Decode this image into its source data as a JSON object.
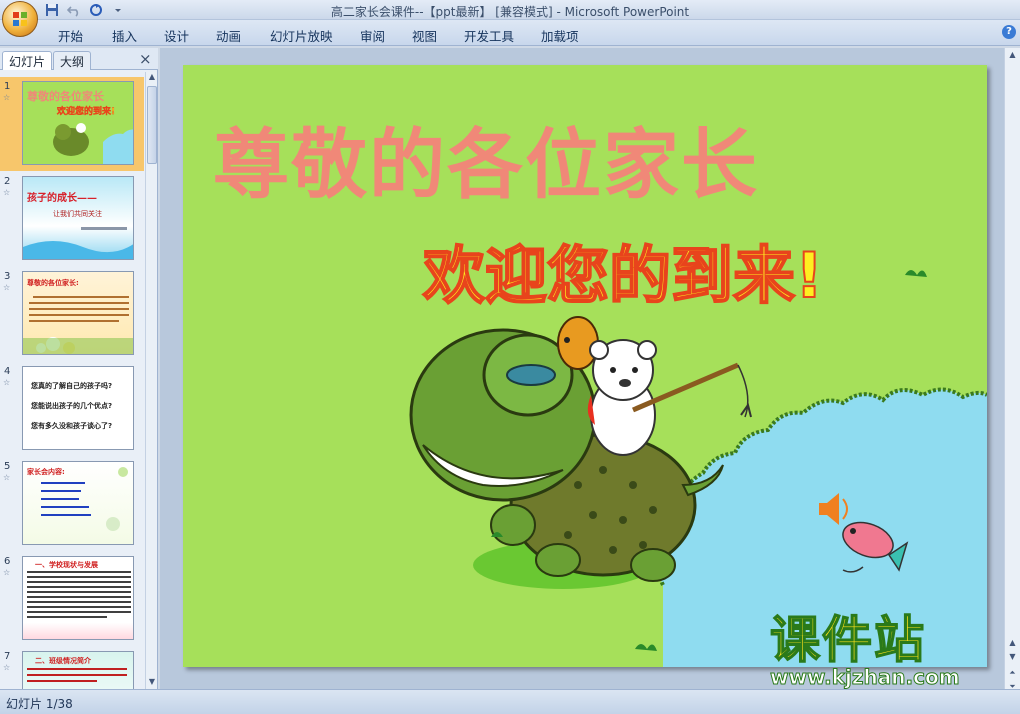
{
  "window": {
    "title": "高二家长会课件--【ppt最新】 [兼容模式] - Microsoft PowerPoint"
  },
  "quick_access": [
    {
      "icon": "save-icon"
    },
    {
      "icon": "undo-icon"
    },
    {
      "icon": "redo-icon"
    },
    {
      "icon": "customize-dropdown-icon"
    }
  ],
  "menu": {
    "items": [
      {
        "label": "开始"
      },
      {
        "label": "插入"
      },
      {
        "label": "设计"
      },
      {
        "label": "动画"
      },
      {
        "label": "幻灯片放映"
      },
      {
        "label": "审阅"
      },
      {
        "label": "视图"
      },
      {
        "label": "开发工具"
      },
      {
        "label": "加载项"
      }
    ],
    "help_icon": "?"
  },
  "left_panel": {
    "tabs": [
      {
        "label": "幻灯片"
      },
      {
        "label": "大纲"
      }
    ],
    "close": "×",
    "slides": [
      {
        "num": "1",
        "star": "☆",
        "title": "尊敬的各位家长",
        "subtitle": "欢迎您的到来!"
      },
      {
        "num": "2",
        "star": "☆",
        "title": "孩子的成长——",
        "subtitle": "让我们共同关注"
      },
      {
        "num": "3",
        "star": "☆",
        "title": "尊敬的各位家长:"
      },
      {
        "num": "4",
        "star": "☆",
        "lines": [
          "您真的了解自己的孩子吗?",
          "您能说出孩子的几个优点?",
          "您有多久没和孩子谈心了?"
        ]
      },
      {
        "num": "5",
        "star": "☆",
        "title": "家长会内容:"
      },
      {
        "num": "6",
        "star": "☆",
        "title": "一、学校现状与发展"
      },
      {
        "num": "7",
        "star": "☆",
        "title": "二、班级情况简介"
      }
    ]
  },
  "slide": {
    "title": "尊敬的各位家长",
    "subtitle": "欢迎您的到来!"
  },
  "status": {
    "text": "幻灯片 1/38"
  },
  "watermark": {
    "main": "课件站",
    "url": "www.kjzhan.com"
  },
  "colors": {
    "slide_bg": "#a6e05a",
    "title_color": "#f08878",
    "subtitle_color": "#ffee20",
    "water": "#8fdcf0",
    "selected_thumb": "#f7c66b"
  }
}
